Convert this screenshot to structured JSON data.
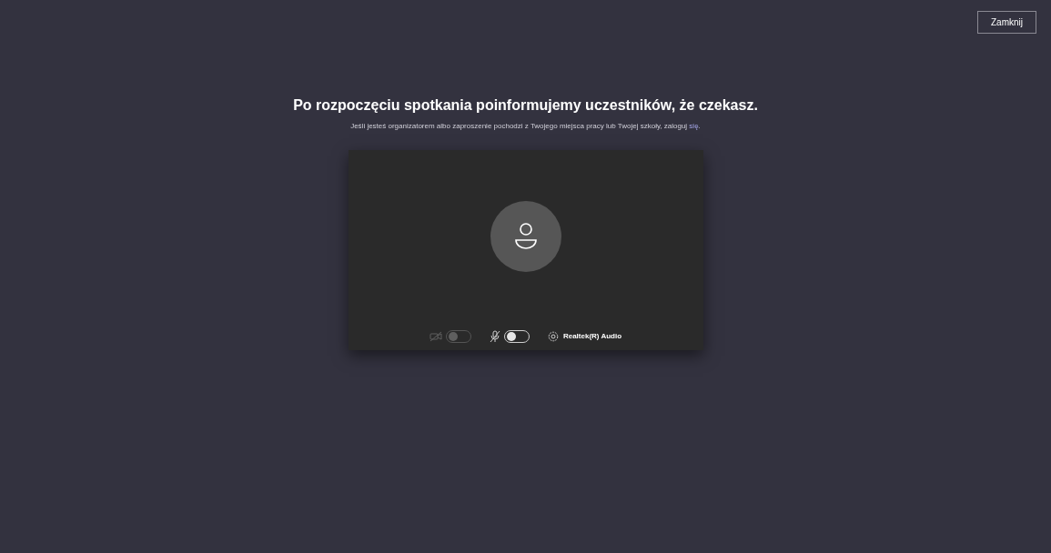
{
  "close_button": "Zamknij",
  "heading": "Po rozpoczęciu spotkania poinformujemy uczestników, że czekasz.",
  "subtext": {
    "text": "Jeśli jesteś organizatorem albo zaproszenie pochodzi z Twojego miejsca pracy lub Twojej szkoły, zaloguj",
    "link": "się",
    "after": "."
  },
  "controls": [
    {
      "kind": "camera",
      "on": false,
      "disabled": true
    },
    {
      "kind": "microphone",
      "on": false,
      "disabled": false
    }
  ],
  "audio_device": "Realtek(R) Audio"
}
